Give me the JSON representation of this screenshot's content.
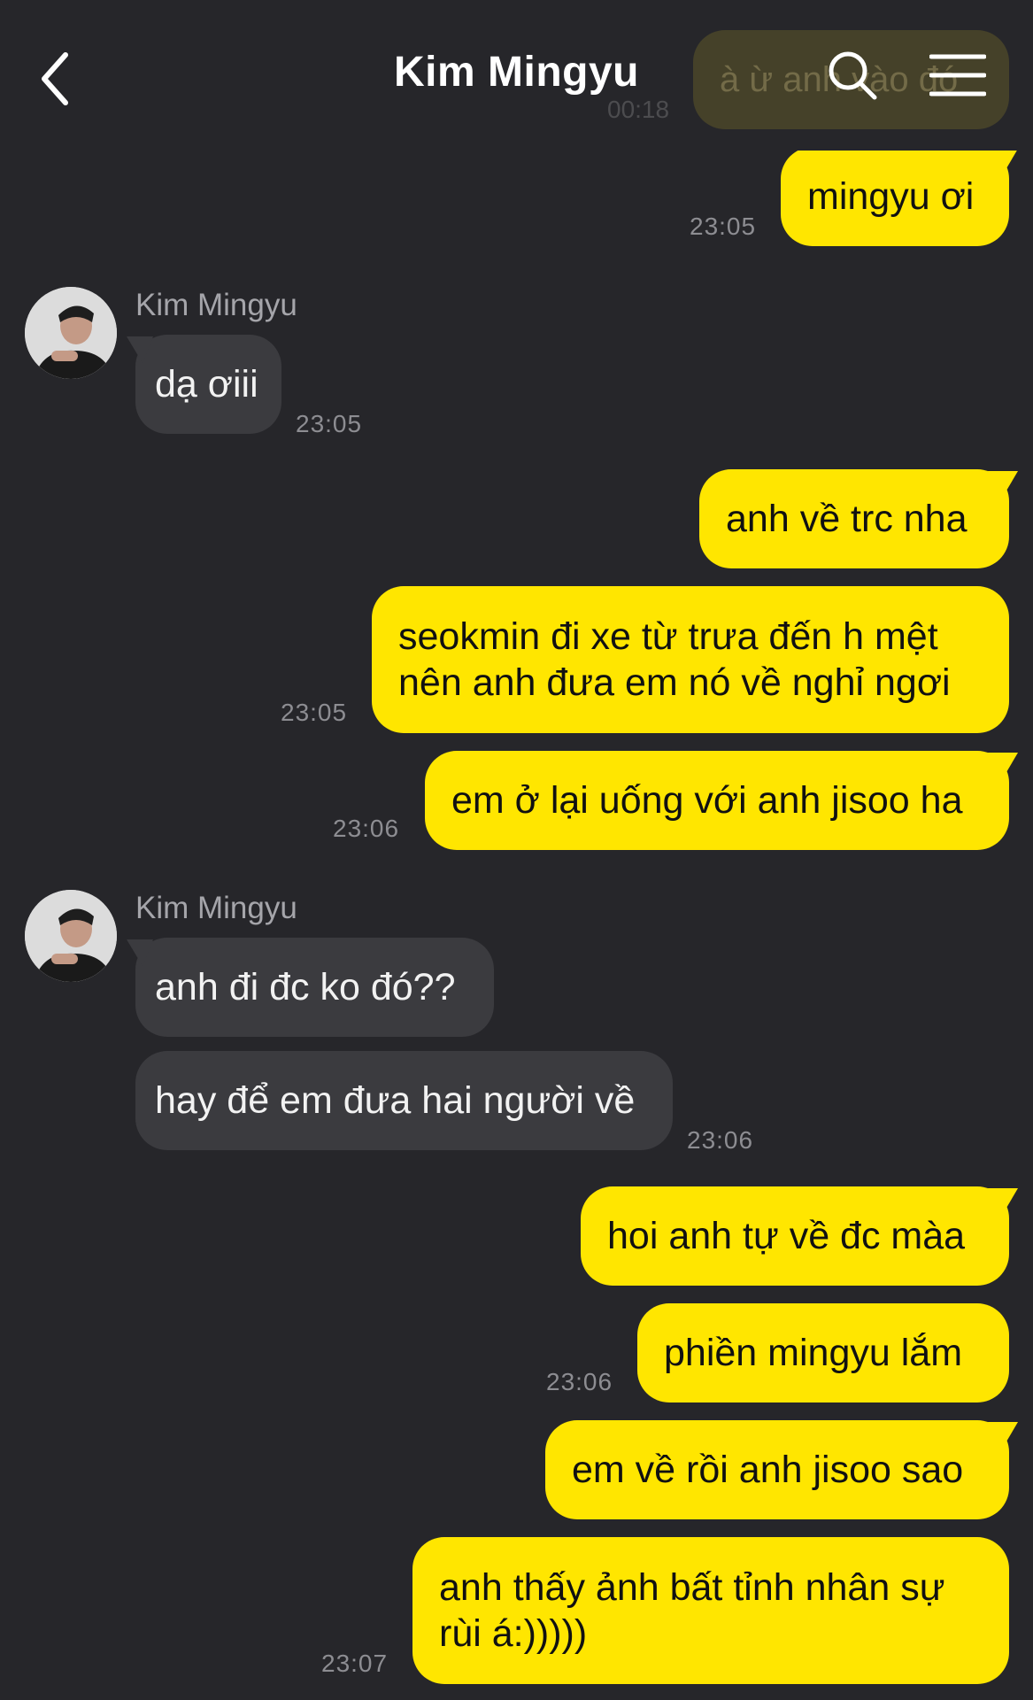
{
  "header": {
    "title": "Kim Mingyu",
    "ghost_text": "à ừ anh vào đó",
    "ghost_time": "00:18"
  },
  "colors": {
    "background": "#26262a",
    "outgoing_bubble": "#ffe600",
    "incoming_bubble": "#3b3b3f"
  },
  "messages": [
    {
      "text": "mingyu ơi",
      "time": "23:05"
    },
    {
      "sender": "Kim Mingyu",
      "text": "dạ ơiii",
      "time": "23:05"
    },
    {
      "text": "anh về trc nha"
    },
    {
      "text": "seokmin đi xe từ trưa đến h mệt nên anh đưa em nó về nghỉ ngơi",
      "time": "23:05"
    },
    {
      "text": "em ở lại uống với anh jisoo ha",
      "time": "23:06"
    },
    {
      "sender": "Kim Mingyu",
      "text": "anh đi đc ko đó??"
    },
    {
      "text": "hay để em đưa hai người về",
      "time": "23:06"
    },
    {
      "text": "hoi anh tự về đc màa"
    },
    {
      "text": "phiền mingyu lắm",
      "time": "23:06"
    },
    {
      "text": "em về rồi anh jisoo sao"
    },
    {
      "text": "anh thấy ảnh bất tỉnh nhân sự rùi á:)))))",
      "time": "23:07"
    }
  ]
}
